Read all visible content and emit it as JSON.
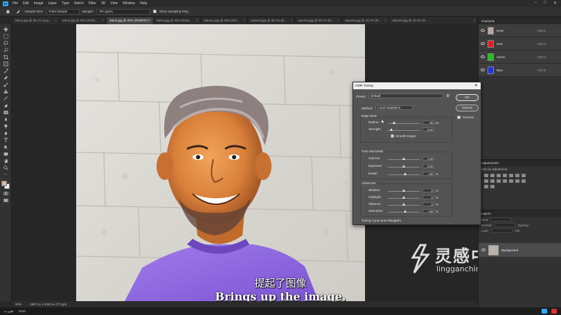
{
  "menu": {
    "logo": "Ps",
    "items": [
      "File",
      "Edit",
      "Image",
      "Layer",
      "Type",
      "Select",
      "Filter",
      "3D",
      "View",
      "Window",
      "Help"
    ]
  },
  "options": {
    "sample_size_label": "Sample Size:",
    "sample_size_value": "Point Sample",
    "sample_label": "Sample:",
    "sample_value": "All Layers",
    "show_ring_label": "Show Sampling Ring"
  },
  "tabs": [
    {
      "label": "Man1.jpg @ 66.7% (Lay...",
      "active": false
    },
    {
      "label": "Man2.jpg @ 25% (RGB...",
      "active": false
    },
    {
      "label": "Man3.jpg @ 50% (RGB/32*) *",
      "active": true
    },
    {
      "label": "Man4.jpg @ 25% (RGB...",
      "active": false
    },
    {
      "label": "nature1.jpg @ 25% (RG...",
      "active": false
    },
    {
      "label": "nature2.jpg @ 66.7% (R...",
      "active": false
    },
    {
      "label": "nature3.jpg @ 66.7% (R...",
      "active": false
    },
    {
      "label": "nature5.jpg @ 16.7% (R...",
      "active": false
    },
    {
      "label": "nature6.jpg @ 33.3% (R...",
      "active": false
    }
  ],
  "dialog": {
    "title": "HDR Toning",
    "preset_label": "Preset:",
    "preset_value": "Default",
    "method_label": "Method:",
    "method_value": "Local Adaptation",
    "ok_label": "OK",
    "cancel_label": "Cancel",
    "preview_label": "Preview",
    "preview_checked": true,
    "edge_glow": {
      "title": "Edge Glow",
      "radius_label": "Radius:",
      "radius_value": "99",
      "radius_unit": "px",
      "radius_level": 0.2,
      "strength_label": "Strength:",
      "strength_value": "0.52",
      "strength_level": 0.12,
      "smooth_edges_label": "Smooth Edges"
    },
    "tone_detail": {
      "title": "Tone and Detail",
      "gamma_label": "Gamma:",
      "gamma_value": "1.00",
      "gamma_level": 0.5,
      "exposure_label": "Exposure:",
      "exposure_value": "0.00",
      "exposure_level": 0.5,
      "detail_label": "Detail:",
      "detail_value": "+30",
      "detail_unit": "%",
      "detail_level": 0.55
    },
    "advanced": {
      "title": "Advanced",
      "shadow_label": "Shadow:",
      "shadow_value": "0",
      "highlight_label": "Highlight:",
      "highlight_value": "0",
      "vibrance_label": "Vibrance:",
      "vibrance_value": "0",
      "saturation_label": "Saturation:",
      "saturation_value": "+20",
      "unit": "%",
      "shadow_level": 0.5,
      "highlight_level": 0.5,
      "vibrance_level": 0.5,
      "saturation_level": 0.55
    },
    "curve_title": "Toning Curve and Histogram"
  },
  "channels_panel": {
    "title": "Channels",
    "rows": [
      {
        "name": "RGB",
        "key": "Ctrl+2",
        "color": "#b8a8a0"
      },
      {
        "name": "Red",
        "key": "Ctrl+3",
        "color": "#e02020"
      },
      {
        "name": "Green",
        "key": "Ctrl+4",
        "color": "#20c020"
      },
      {
        "name": "Blue",
        "key": "Ctrl+5",
        "color": "#2030e0"
      }
    ]
  },
  "adjustments_panel": {
    "title": "Adjustments",
    "subtitle": "Add an adjustment"
  },
  "layers_panel": {
    "title": "Layers",
    "kind_label": "Kind",
    "normal_label": "Normal",
    "opacity_label": "Opacity:",
    "lock_label": "Lock:",
    "fill_label": "Fill:",
    "layer_name": "Background"
  },
  "status": {
    "zoom": "50%",
    "doc": "1967 px x 3000 px (72 ppi)"
  },
  "taskbar": {
    "lang": "ENG",
    "left_text": "فلیو دے"
  },
  "subtitles": {
    "cn": "提起了图像",
    "en": "Brings up the image."
  },
  "watermark": {
    "cn": "灵感中国",
    "en": "lingganchina.com"
  }
}
